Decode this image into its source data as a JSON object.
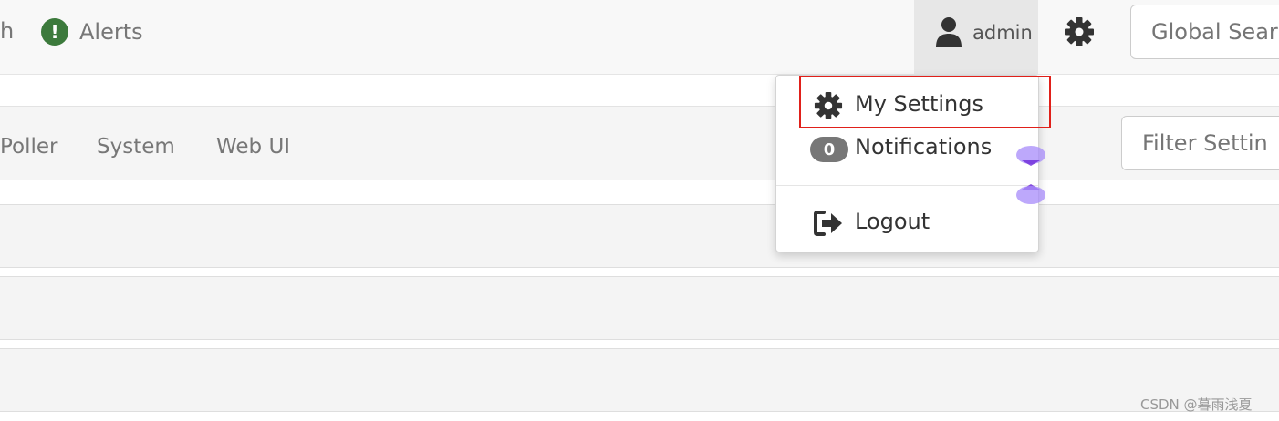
{
  "topbar": {
    "nav_partial": "h",
    "alerts_label": "Alerts",
    "alert_icon_glyph": "!",
    "user_name": "admin",
    "global_search_placeholder": "Global Sear"
  },
  "tabs": [
    "Poller",
    "System",
    "Web UI"
  ],
  "filter_placeholder": "Filter Settin",
  "user_dropdown": {
    "my_settings": "My Settings",
    "notifications_count": "0",
    "notifications": "Notifications",
    "logout": "Logout"
  },
  "watermark": "CSDN @暮雨浅夏",
  "colors": {
    "alert_green": "#3c7a3c",
    "highlight_red": "#e0201a",
    "badge_gray": "#777777",
    "cursor_purple": "#a78bfa"
  },
  "icons": [
    "alert-icon",
    "user-icon",
    "gear-icon",
    "settings-gear-icon",
    "logout-icon"
  ]
}
